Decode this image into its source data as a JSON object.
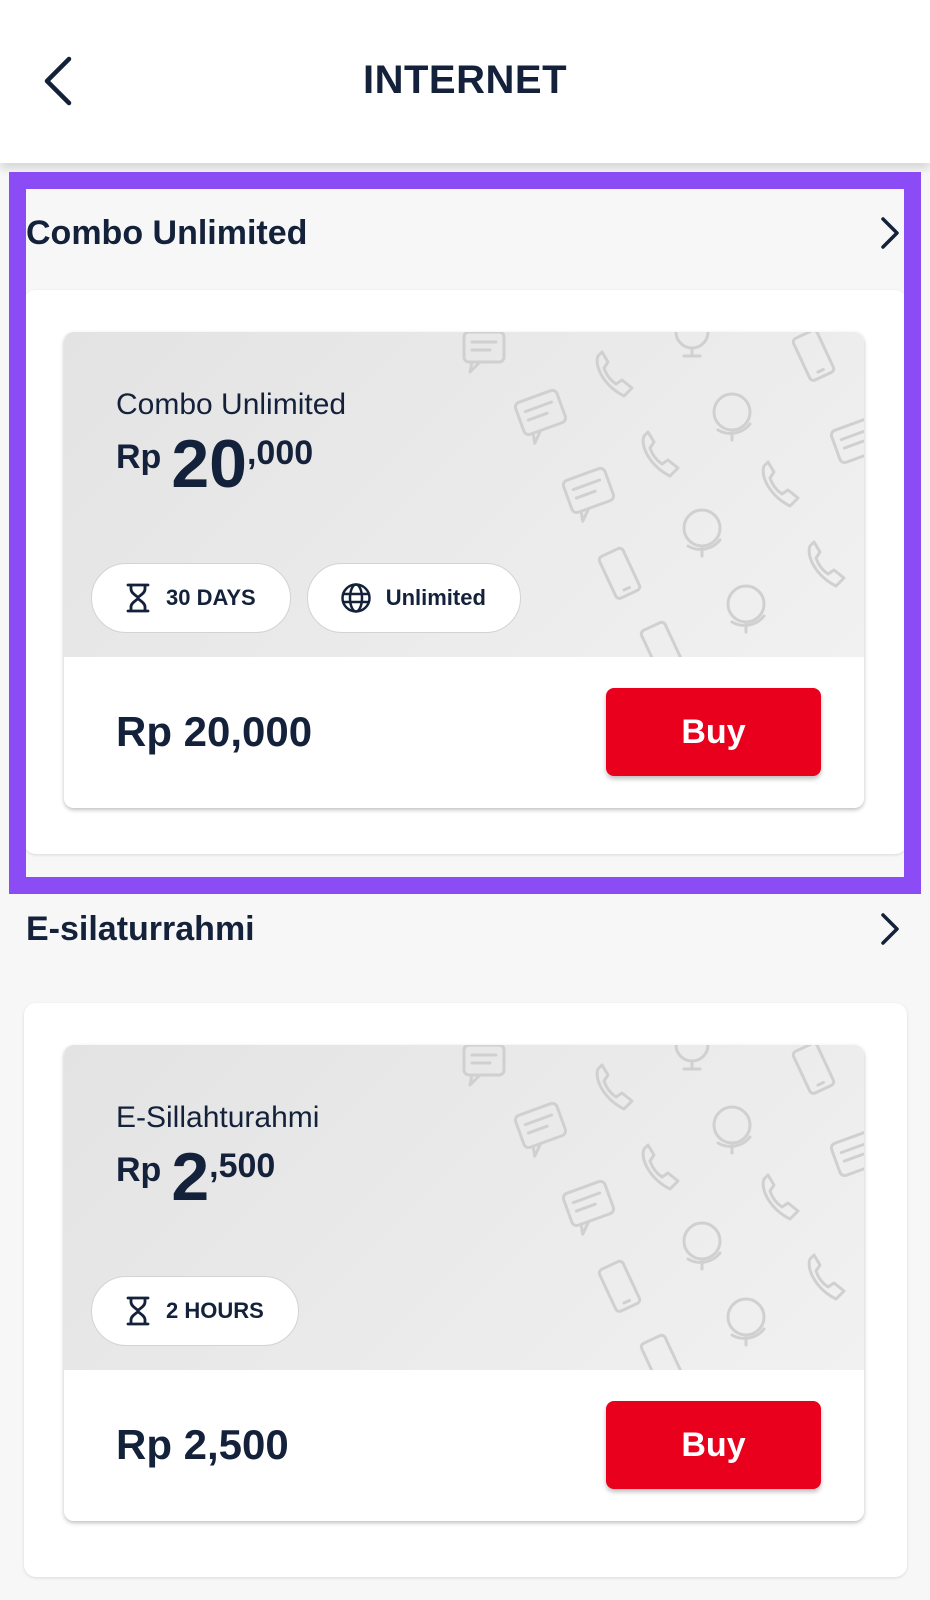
{
  "header": {
    "title": "INTERNET",
    "back_icon": "chevron-left-icon"
  },
  "sections": [
    {
      "title": "Combo Unlimited",
      "package": {
        "name": "Combo Unlimited",
        "currency": "Rp",
        "price_main": "20",
        "price_dec": ",000",
        "chips": [
          {
            "icon": "hourglass-icon",
            "label": "30 DAYS"
          },
          {
            "icon": "globe-icon",
            "label": "Unlimited"
          }
        ],
        "total": "Rp 20,000",
        "buy_label": "Buy"
      }
    },
    {
      "title": "E-silaturrahmi",
      "package": {
        "name": "E-Sillahturahmi",
        "currency": "Rp",
        "price_main": "2",
        "price_dec": ",500",
        "chips": [
          {
            "icon": "hourglass-icon",
            "label": "2 HOURS"
          }
        ],
        "total": "Rp 2,500",
        "buy_label": "Buy"
      }
    }
  ],
  "colors": {
    "accent": "#e8001c",
    "highlight": "#8c4cf5",
    "text": "#14213a"
  }
}
